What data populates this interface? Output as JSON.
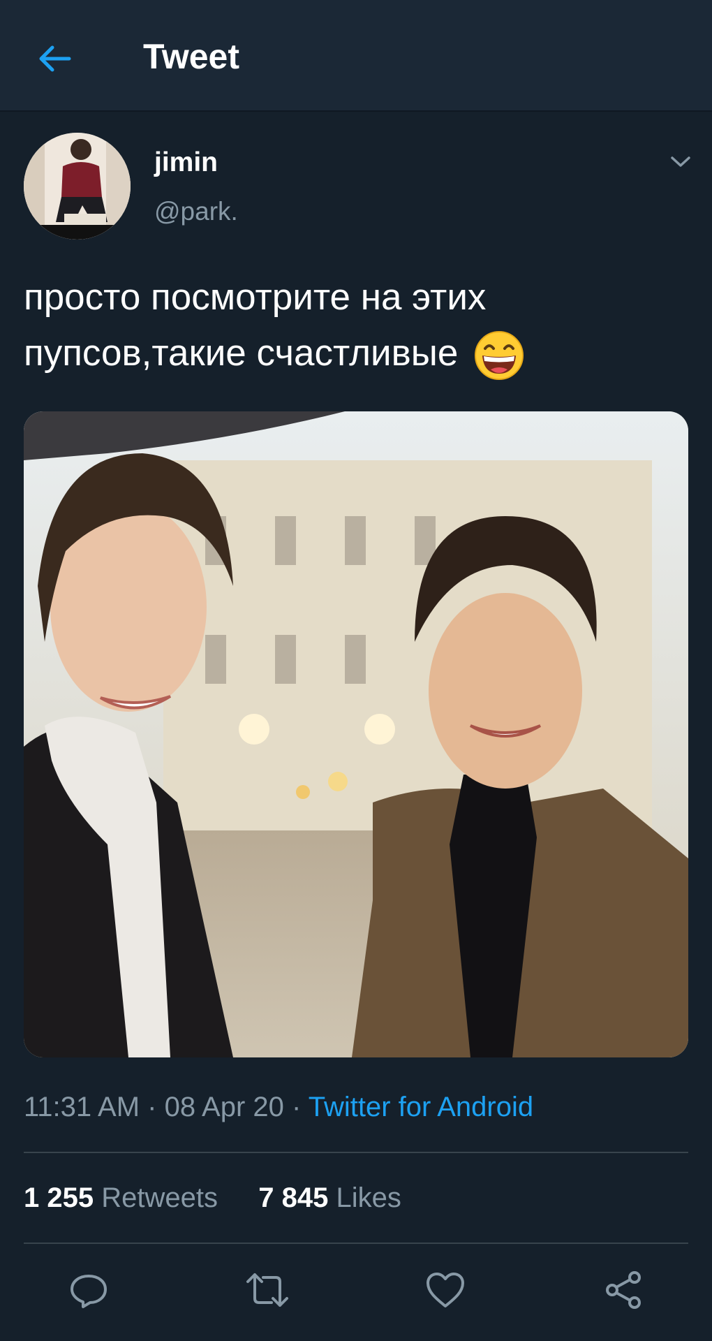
{
  "header": {
    "title": "Tweet",
    "back_icon": "arrow-left-icon"
  },
  "author": {
    "name": "jimin",
    "handle": "@park."
  },
  "tweet": {
    "text": "просто посмотрите на этих пупсов,такие счастливые",
    "emoji": "grinning-face-with-smiling-eyes"
  },
  "meta": {
    "time": "11:31 AM",
    "separator": "·",
    "date": "08 Apr 20",
    "source": "Twitter for Android"
  },
  "stats": {
    "retweets_count": "1 255",
    "retweets_label": "Retweets",
    "likes_count": "7 845",
    "likes_label": "Likes"
  },
  "actions": [
    "reply-icon",
    "retweet-icon",
    "like-icon",
    "share-icon"
  ],
  "colors": {
    "background": "#15202b",
    "header": "#1b2836",
    "accent": "#1da1f2",
    "secondary_text": "#8899a6",
    "divider": "#38444d"
  }
}
